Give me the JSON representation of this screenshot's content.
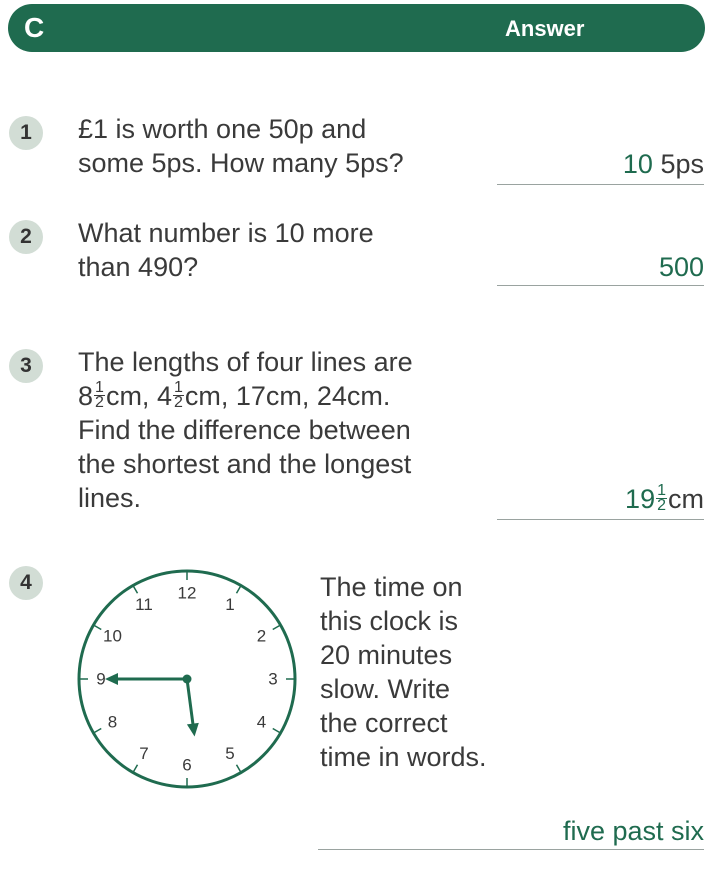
{
  "header": {
    "section_letter": "C",
    "answer_label": "Answer"
  },
  "questions": [
    {
      "number": "1",
      "lines": [
        "£1 is worth one 50p and",
        "some 5ps. How many 5ps?"
      ],
      "answer_value": "10",
      "answer_unit": "5ps"
    },
    {
      "number": "2",
      "lines": [
        "What number is 10 more",
        "than 490?"
      ],
      "answer_value": "500"
    },
    {
      "number": "3",
      "line1": "The lengths of four lines are",
      "line2": {
        "whole_a": "8",
        "frac_a_num": "1",
        "frac_a_den": "2",
        "unit_a": "cm, ",
        "whole_b": "4",
        "frac_b_num": "1",
        "frac_b_den": "2",
        "unit_b": "cm, 17cm, 24cm."
      },
      "lines_rest": [
        "Find the difference between",
        "the shortest and the longest",
        "lines."
      ],
      "answer_whole": "19",
      "answer_frac_num": "1",
      "answer_frac_den": "2",
      "answer_unit": "cm"
    },
    {
      "number": "4",
      "lines": [
        "The time on",
        "this clock is",
        "20 minutes",
        "slow. Write",
        "the correct",
        "time in words."
      ],
      "answer_value": "five past six"
    }
  ],
  "clock": {
    "numbers": [
      "12",
      "1",
      "2",
      "3",
      "4",
      "5",
      "6",
      "7",
      "8",
      "9",
      "10",
      "11"
    ],
    "hour_hand_value": 5.75,
    "minute_hand_value": 45,
    "accent_color": "#1f6b4f"
  },
  "colors": {
    "header_bg": "#1f6b4f",
    "number_badge_bg": "#d2ddd5",
    "answer_text": "#1f6b4f",
    "body_text": "#3a3a3a"
  }
}
